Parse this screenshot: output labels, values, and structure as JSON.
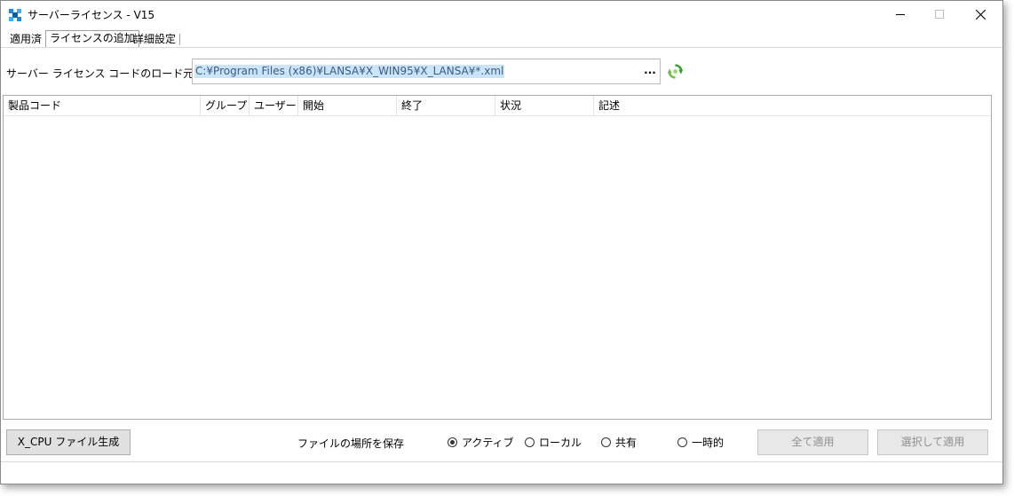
{
  "window": {
    "title": "サーバーライセンス - V15",
    "controls": {
      "minimize": "minimize-icon",
      "maximize": "maximize-icon",
      "close": "close-icon"
    }
  },
  "tabs": [
    {
      "label": "適用済",
      "active": false
    },
    {
      "label": "ライセンスの追加",
      "active": true
    },
    {
      "label": "詳細設定",
      "active": false
    }
  ],
  "source": {
    "label": "サーバー ライセンス コードのロード元",
    "value": "C:¥Program Files (x86)¥LANSA¥X_WIN95¥X_LANSA¥*.xml",
    "browse_label": "...",
    "refresh_icon": "refresh-icon"
  },
  "grid": {
    "columns": [
      "製品コード",
      "グループ",
      "ユーザー...",
      "開始",
      "終了",
      "状況",
      "記述"
    ],
    "rows": []
  },
  "footer": {
    "generate_button": "X_CPU ファイル生成",
    "save_location_label": "ファイルの場所を保存",
    "radios": [
      {
        "label": "アクティブ",
        "checked": true
      },
      {
        "label": "ローカル",
        "checked": false
      },
      {
        "label": "共有",
        "checked": false
      },
      {
        "label": "一時的",
        "checked": false
      }
    ],
    "apply_all_button": "全て適用",
    "apply_selected_button": "選択して適用"
  },
  "colors": {
    "selection": "#cce4f7",
    "accent": "#0078d7",
    "refresh_green": "#4caf50"
  }
}
